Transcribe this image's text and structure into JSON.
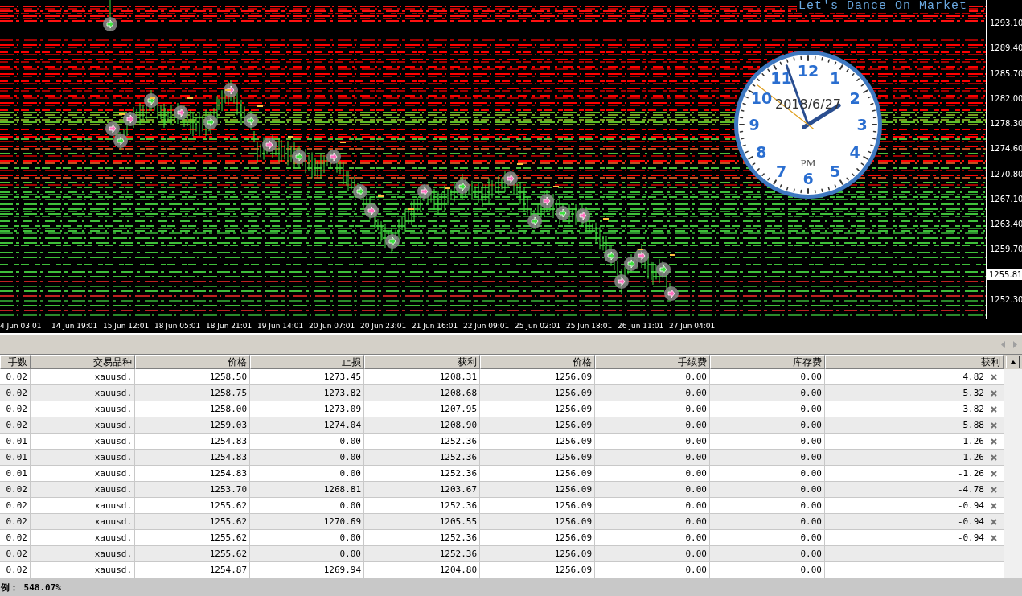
{
  "chart": {
    "title": "Let's Dance On Market",
    "y_labels": [
      {
        "text": "1293.10",
        "kind": "tick"
      },
      {
        "text": "1289.40",
        "kind": "tick"
      },
      {
        "text": "1285.70",
        "kind": "tick"
      },
      {
        "text": "1282.00",
        "kind": "tick"
      },
      {
        "text": "1278.30",
        "kind": "tick"
      },
      {
        "text": "1274.60",
        "kind": "tick"
      },
      {
        "text": "1270.80",
        "kind": "tick"
      },
      {
        "text": "1267.10",
        "kind": "tick"
      },
      {
        "text": "1263.40",
        "kind": "tick"
      },
      {
        "text": "1259.70",
        "kind": "tick"
      },
      {
        "text": "1255.81",
        "kind": "current"
      },
      {
        "text": "1252.30",
        "kind": "tick"
      }
    ],
    "x_labels": [
      "4 Jun 03:01",
      "14 Jun 19:01",
      "15 Jun 12:01",
      "18 Jun 05:01",
      "18 Jun 21:01",
      "19 Jun 14:01",
      "20 Jun 07:01",
      "20 Jun 23:01",
      "21 Jun 16:01",
      "22 Jun 09:01",
      "25 Jun 02:01",
      "25 Jun 18:01",
      "26 Jun 11:01",
      "27 Jun 04:01"
    ]
  },
  "clock": {
    "numerals": [
      "12",
      "11",
      "1",
      "10",
      "2",
      "9",
      "3",
      "8",
      "4",
      "7",
      "5",
      "6"
    ],
    "date": "2018/6/27",
    "meridiem": "PM"
  },
  "table": {
    "columns": [
      "手数",
      "交易品种",
      "价格",
      "止损",
      "获利",
      "价格",
      "手续费",
      "库存费",
      "获利"
    ],
    "rows": [
      {
        "cells": [
          "0.02",
          "xauusd.",
          "1258.50",
          "1273.45",
          "1208.31",
          "1256.09",
          "0.00",
          "0.00",
          "4.82"
        ]
      },
      {
        "cells": [
          "0.02",
          "xauusd.",
          "1258.75",
          "1273.82",
          "1208.68",
          "1256.09",
          "0.00",
          "0.00",
          "5.32"
        ]
      },
      {
        "cells": [
          "0.02",
          "xauusd.",
          "1258.00",
          "1273.09",
          "1207.95",
          "1256.09",
          "0.00",
          "0.00",
          "3.82"
        ]
      },
      {
        "cells": [
          "0.02",
          "xauusd.",
          "1259.03",
          "1274.04",
          "1208.90",
          "1256.09",
          "0.00",
          "0.00",
          "5.88"
        ]
      },
      {
        "cells": [
          "0.01",
          "xauusd.",
          "1254.83",
          "0.00",
          "1252.36",
          "1256.09",
          "0.00",
          "0.00",
          "-1.26"
        ]
      },
      {
        "cells": [
          "0.01",
          "xauusd.",
          "1254.83",
          "0.00",
          "1252.36",
          "1256.09",
          "0.00",
          "0.00",
          "-1.26"
        ]
      },
      {
        "cells": [
          "0.01",
          "xauusd.",
          "1254.83",
          "0.00",
          "1252.36",
          "1256.09",
          "0.00",
          "0.00",
          "-1.26"
        ]
      },
      {
        "cells": [
          "0.02",
          "xauusd.",
          "1253.70",
          "1268.81",
          "1203.67",
          "1256.09",
          "0.00",
          "0.00",
          "-4.78"
        ]
      },
      {
        "cells": [
          "0.02",
          "xauusd.",
          "1255.62",
          "0.00",
          "1252.36",
          "1256.09",
          "0.00",
          "0.00",
          "-0.94"
        ]
      },
      {
        "cells": [
          "0.02",
          "xauusd.",
          "1255.62",
          "1270.69",
          "1205.55",
          "1256.09",
          "0.00",
          "0.00",
          "-0.94"
        ]
      },
      {
        "cells": [
          "0.02",
          "xauusd.",
          "1255.62",
          "0.00",
          "1252.36",
          "1256.09",
          "0.00",
          "0.00",
          "-0.94"
        ]
      },
      {
        "cells": [
          "0.02",
          "xauusd.",
          "1255.62",
          "0.00",
          "1252.36",
          "1256.09",
          "0.00",
          "0.00"
        ]
      },
      {
        "cells": [
          "0.02",
          "xauusd.",
          "1254.87",
          "1269.94",
          "1204.80",
          "1256.09",
          "0.00",
          "0.00"
        ]
      }
    ]
  },
  "status_bar": {
    "text": "例： 548.07%"
  }
}
